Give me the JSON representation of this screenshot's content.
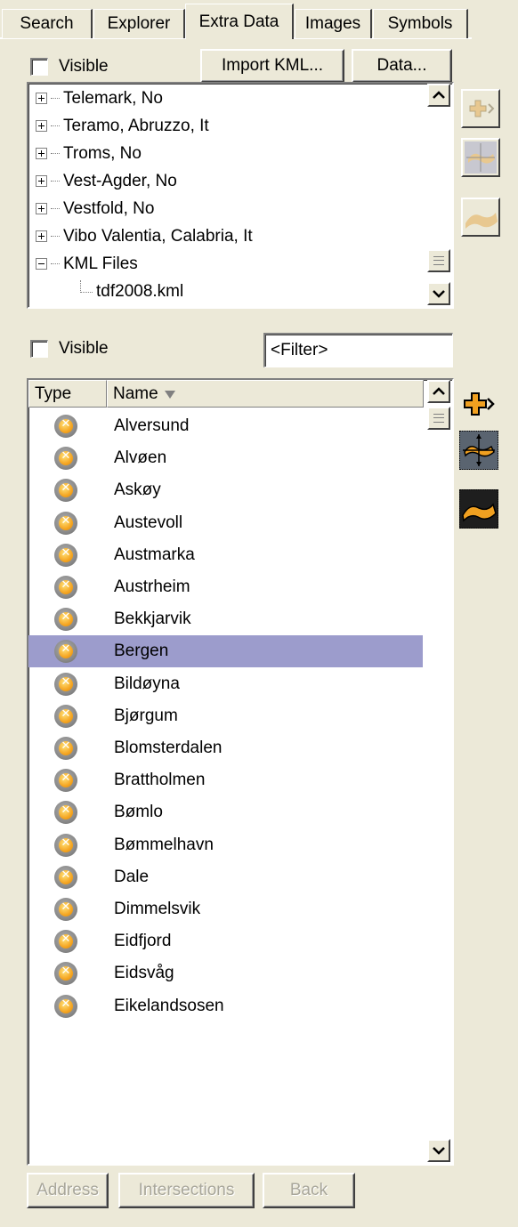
{
  "tabs": [
    {
      "label": "Search"
    },
    {
      "label": "Explorer"
    },
    {
      "label": "Extra Data"
    },
    {
      "label": "Images"
    },
    {
      "label": "Symbols"
    }
  ],
  "top_panel": {
    "visible_label": "Visible",
    "import_kml_label": "Import KML...",
    "data_label": "Data...",
    "tree_items": [
      {
        "label": "Telemark, No",
        "expander": "plus"
      },
      {
        "label": "Teramo, Abruzzo, It",
        "expander": "plus"
      },
      {
        "label": "Troms, No",
        "expander": "plus"
      },
      {
        "label": "Vest-Agder, No",
        "expander": "plus"
      },
      {
        "label": "Vestfold, No",
        "expander": "plus"
      },
      {
        "label": "Vibo Valentia, Calabria, It",
        "expander": "plus"
      },
      {
        "label": "KML Files",
        "expander": "minus"
      },
      {
        "label": "tdf2008.kml",
        "expander": "none"
      }
    ]
  },
  "bottom_panel": {
    "visible_label": "Visible",
    "filter_value": "<Filter>",
    "columns": {
      "type": "Type",
      "name": "Name"
    },
    "selected_index": 7,
    "rows": [
      "Alversund",
      "Alvøen",
      "Askøy",
      "Austevoll",
      "Austmarka",
      "Austrheim",
      "Bekkjarvik",
      "Bergen",
      "Bildøyna",
      "Bjørgum",
      "Blomsterdalen",
      "Brattholmen",
      "Bømlo",
      "Bømmelhavn",
      "Dale",
      "Dimmelsvik",
      "Eidfjord",
      "Eidsvåg",
      "Eikelandsosen"
    ]
  },
  "footer": {
    "address_label": "Address",
    "intersections_label": "Intersections",
    "back_label": "Back"
  },
  "colors": {
    "background": "#ece9d8",
    "selection": "#9c9ccc",
    "icon_orange": "#f5a623"
  }
}
